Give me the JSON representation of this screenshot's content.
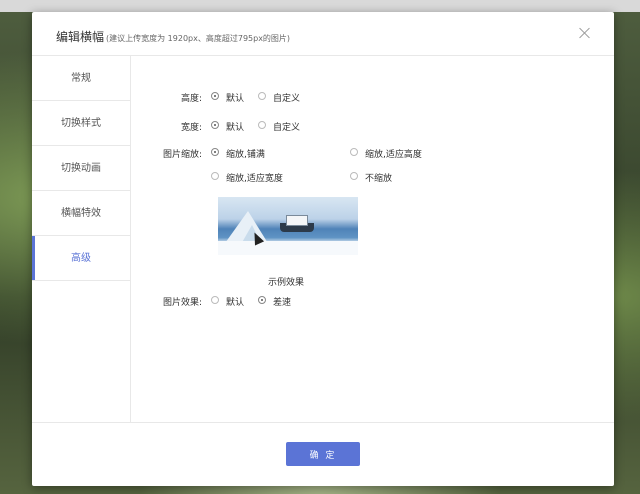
{
  "dialog": {
    "title": "编辑横幅",
    "subtitle": "(建议上传宽度为 1920px、高度超过795px的图片)",
    "confirm_label": "确 定"
  },
  "sidebar": {
    "items": [
      {
        "label": "常规"
      },
      {
        "label": "切换样式"
      },
      {
        "label": "切换动画"
      },
      {
        "label": "横幅特效"
      },
      {
        "label": "高级",
        "active": true
      }
    ]
  },
  "form": {
    "height": {
      "label": "高度:",
      "options": [
        "默认",
        "自定义"
      ],
      "selected": "默认"
    },
    "width": {
      "label": "宽度:",
      "options": [
        "默认",
        "自定义"
      ],
      "selected": "默认"
    },
    "scale": {
      "label": "图片缩放:",
      "options": [
        "缩放,铺满",
        "缩放,适应高度",
        "缩放,适应宽度",
        "不缩放"
      ],
      "selected": "缩放,铺满"
    },
    "preview_caption": "示例效果",
    "effect": {
      "label": "图片效果:",
      "options": [
        "默认",
        "差速"
      ],
      "selected": "差速"
    }
  }
}
